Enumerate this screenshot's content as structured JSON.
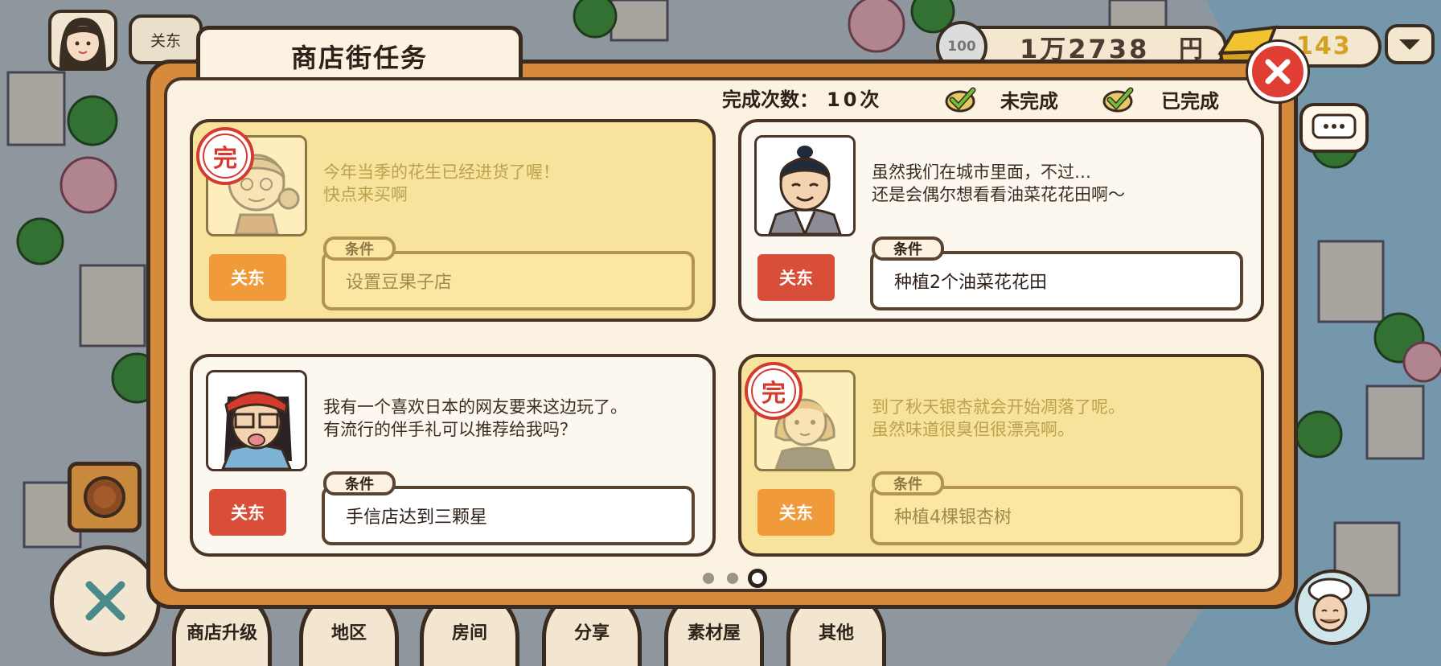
{
  "hud": {
    "region": "关东",
    "coin_label": "100",
    "money": "1万2738",
    "money_unit": "円",
    "gold": "143"
  },
  "dialog": {
    "title": "商店街任务",
    "count_label": "完成次数：",
    "count_value": "10次",
    "legend_incomplete": "未完成",
    "legend_complete": "已完成",
    "condition_label": "条件",
    "done_stamp": "完"
  },
  "quests": [
    {
      "status": "done",
      "message": "今年当季的花生已经进货了喔！\n快点来买啊",
      "region": "关东",
      "condition": "设置豆果子店",
      "portrait": "old-woman-portrait"
    },
    {
      "status": "open",
      "message": "虽然我们在城市里面，不过…\n还是会偶尔想看看油菜花花田啊～",
      "region": "关东",
      "condition": "种植2个油菜花花田",
      "portrait": "kimono-man-portrait"
    },
    {
      "status": "open",
      "message": "我有一个喜欢日本的网友要来这边玩了。\n有流行的伴手礼可以推荐给我吗？",
      "region": "关东",
      "condition": "手信店达到三颗星",
      "portrait": "bandana-man-portrait"
    },
    {
      "status": "done",
      "message": "到了秋天银杏就会开始凋落了呢。\n虽然味道很臭但很漂亮啊。",
      "region": "关东",
      "condition": "种植4棵银杏树",
      "portrait": "bob-hair-woman-portrait"
    }
  ],
  "pager": {
    "pages": 3,
    "current": 3
  },
  "nav": [
    "商店升级",
    "地区",
    "房间",
    "分享",
    "素材屋",
    "其他"
  ],
  "colors": {
    "panel_frame": "#d68a3c",
    "close": "#e03e32",
    "tag_open": "#d94e38",
    "tag_done": "#f09a3a",
    "done_card": "#f8e39c"
  }
}
